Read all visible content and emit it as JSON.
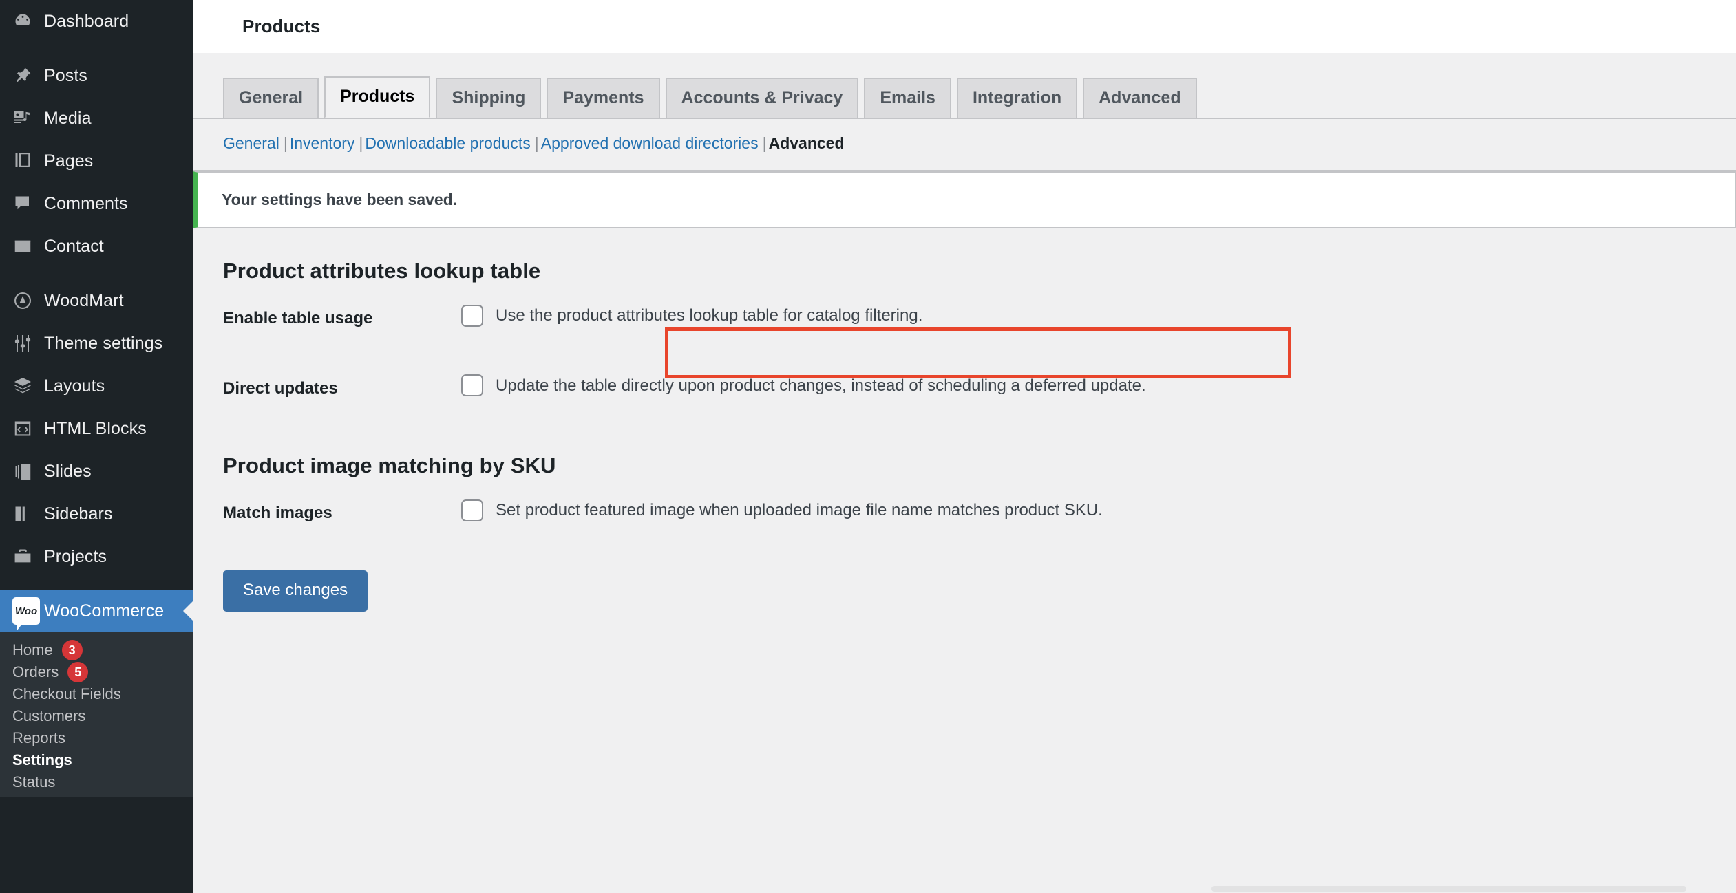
{
  "sidebar": {
    "items": [
      {
        "label": "Dashboard",
        "icon": "dashboard-icon",
        "gap_after": true
      },
      {
        "label": "Posts",
        "icon": "pin-icon",
        "gap_after": false
      },
      {
        "label": "Media",
        "icon": "media-icon",
        "gap_after": false
      },
      {
        "label": "Pages",
        "icon": "pages-icon",
        "gap_after": false
      },
      {
        "label": "Comments",
        "icon": "comments-icon",
        "gap_after": false
      },
      {
        "label": "Contact",
        "icon": "envelope-icon",
        "gap_after": true
      },
      {
        "label": "WoodMart",
        "icon": "woodmart-icon",
        "gap_after": false
      },
      {
        "label": "Theme settings",
        "icon": "sliders-icon",
        "gap_after": false
      },
      {
        "label": "Layouts",
        "icon": "layers-icon",
        "gap_after": false
      },
      {
        "label": "HTML Blocks",
        "icon": "code-block-icon",
        "gap_after": false
      },
      {
        "label": "Slides",
        "icon": "slides-icon",
        "gap_after": false
      },
      {
        "label": "Sidebars",
        "icon": "sidebars-icon",
        "gap_after": false
      },
      {
        "label": "Projects",
        "icon": "briefcase-icon",
        "gap_after": true
      }
    ],
    "active_item": {
      "label": "WooCommerce",
      "icon": "woocommerce-icon",
      "badge_text": "Woo"
    },
    "submenu": [
      {
        "label": "Home",
        "count": "3",
        "current": false
      },
      {
        "label": "Orders",
        "count": "5",
        "current": false
      },
      {
        "label": "Checkout Fields",
        "count": "",
        "current": false
      },
      {
        "label": "Customers",
        "count": "",
        "current": false
      },
      {
        "label": "Reports",
        "count": "",
        "current": false
      },
      {
        "label": "Settings",
        "count": "",
        "current": true
      },
      {
        "label": "Status",
        "count": "",
        "current": false
      }
    ]
  },
  "header": {
    "title": "Products"
  },
  "tabs": [
    {
      "label": "General",
      "active": false
    },
    {
      "label": "Products",
      "active": true
    },
    {
      "label": "Shipping",
      "active": false
    },
    {
      "label": "Payments",
      "active": false
    },
    {
      "label": "Accounts & Privacy",
      "active": false
    },
    {
      "label": "Emails",
      "active": false
    },
    {
      "label": "Integration",
      "active": false
    },
    {
      "label": "Advanced",
      "active": false
    }
  ],
  "subnav": [
    {
      "label": "General",
      "current": false
    },
    {
      "label": "Inventory",
      "current": false
    },
    {
      "label": "Downloadable products",
      "current": false
    },
    {
      "label": "Approved download directories",
      "current": false
    },
    {
      "label": "Advanced",
      "current": true
    }
  ],
  "notice": {
    "text": "Your settings have been saved.",
    "accent_color": "#46b450"
  },
  "sections": [
    {
      "title": "Product attributes lookup table",
      "rows": [
        {
          "label": "Enable table usage",
          "checkbox_label": "Use the product attributes lookup table for catalog filtering.",
          "checked": false,
          "highlighted": true
        },
        {
          "label": "Direct updates",
          "checkbox_label": "Update the table directly upon product changes, instead of scheduling a deferred update.",
          "checked": false,
          "highlighted": false
        }
      ]
    },
    {
      "title": "Product image matching by SKU",
      "rows": [
        {
          "label": "Match images",
          "checkbox_label": "Set product featured image when uploaded image file name matches product SKU.",
          "checked": false,
          "highlighted": false
        }
      ]
    }
  ],
  "save_button": {
    "label": "Save changes",
    "color": "#3a6fa5"
  },
  "highlight": {
    "color": "#e8452c"
  }
}
